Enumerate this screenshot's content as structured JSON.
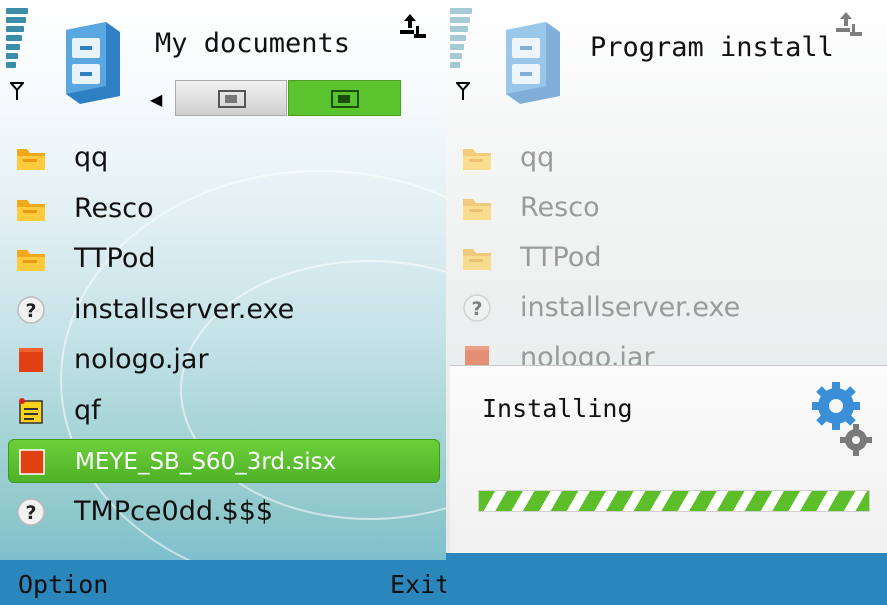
{
  "left": {
    "title": "My documents",
    "list": [
      {
        "label": "qq",
        "icon": "folder-icon"
      },
      {
        "label": "Resco",
        "icon": "folder-icon"
      },
      {
        "label": "TTPod",
        "icon": "folder-icon"
      },
      {
        "label": "installserver.exe",
        "icon": "unknown-file-icon"
      },
      {
        "label": "nologo.jar",
        "icon": "java-app-icon"
      },
      {
        "label": "qf",
        "icon": "notes-file-icon"
      },
      {
        "label": "MEYE_SB_S60_3rd.sisx",
        "icon": "install-package-icon",
        "selected": true
      },
      {
        "label": "TMPce0dd.$$$",
        "icon": "unknown-file-icon"
      }
    ],
    "softkeys": {
      "left": "Option",
      "right": "Exit"
    }
  },
  "right": {
    "title": "Program install",
    "list": [
      {
        "label": "qq"
      },
      {
        "label": "Resco"
      },
      {
        "label": "TTPod"
      },
      {
        "label": "installserver.exe"
      },
      {
        "label": "nologo.jar"
      }
    ],
    "dialog": {
      "text": "Installing",
      "progress_fraction": 1.0
    }
  },
  "colors": {
    "accent_green": "#5bc32d",
    "softbar_blue": "#2b86bc"
  }
}
